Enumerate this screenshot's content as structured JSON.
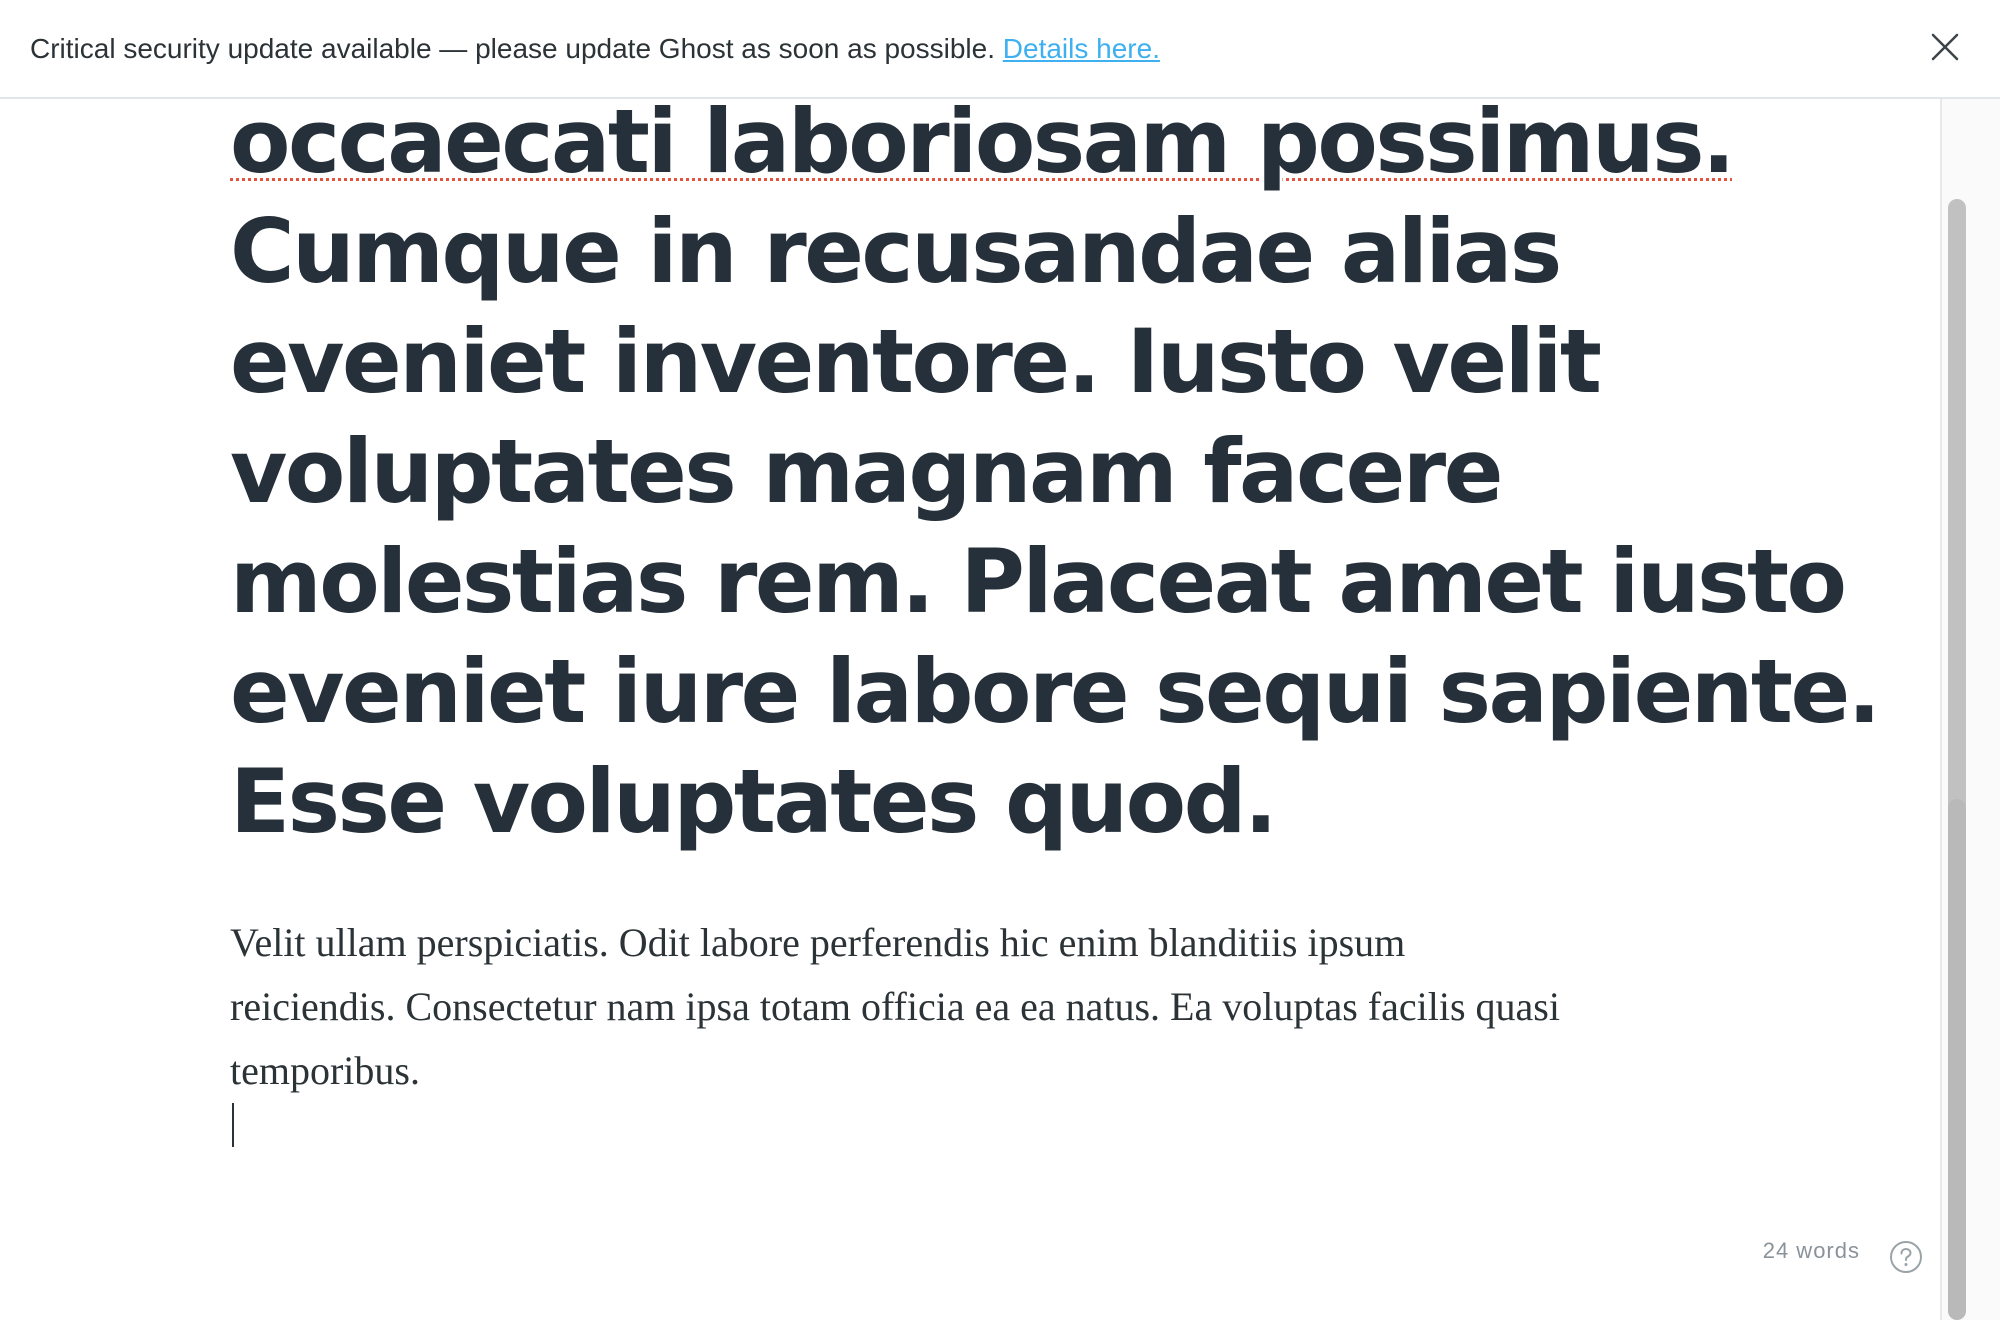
{
  "banner": {
    "message": "Critical security update available — please update Ghost as soon as possible.",
    "link_label": "Details here.",
    "close_icon": "close-icon"
  },
  "post": {
    "title_lines": [
      "occaecati laboriosam possimus.",
      "Cumque in recusandae alias",
      "eveniet inventore. Iusto velit",
      "voluptates magnam facere",
      "molestias rem. Placeat amet iusto",
      "eveniet iure labore sequi sapiente.",
      "Esse voluptates quod."
    ],
    "body_lines": [
      "Velit ullam perspiciatis. Odit labore perferendis hic enim blanditiis ipsum",
      "reiciendis. Consectetur nam ipsa totam officia ea ea natus. Ea voluptas facilis quasi",
      "temporibus."
    ]
  },
  "status": {
    "word_count": "24 words",
    "help_icon": "help-circle-icon"
  },
  "colors": {
    "link": "#3eb0ef",
    "text": "#26303a",
    "spellcheck": "#e25440"
  }
}
